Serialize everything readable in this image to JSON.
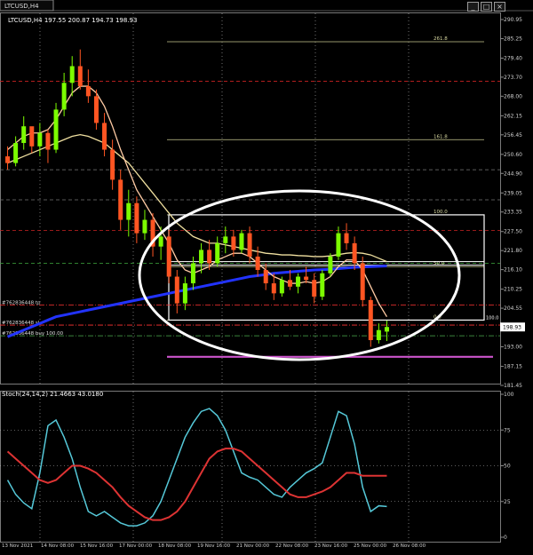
{
  "window": {
    "tab_title": "LTCUSD,H4",
    "buttons": [
      "_",
      "□",
      "×"
    ]
  },
  "chart_data": [
    {
      "type": "candlestick",
      "symbol": "LTCUSD",
      "timeframe": "H4",
      "header": "LTCUSD,H4  197.55 200.87 194.73 198.93",
      "ohlc_header": {
        "open": 197.55,
        "high": 200.87,
        "low": 194.73,
        "close": 198.93
      },
      "ylim": [
        181.45,
        290.95
      ],
      "y_ticks": [
        "290.95",
        "285.25",
        "279.40",
        "273.70",
        "268.00",
        "262.15",
        "256.45",
        "250.60",
        "244.90",
        "239.05",
        "233.35",
        "227.50",
        "221.80",
        "216.10",
        "210.25",
        "204.55",
        "198.93",
        "193.00",
        "187.15",
        "181.45"
      ],
      "last_price": "198.93",
      "x_ticks": [
        "13 Nov 2021",
        "14 Nov 08:00",
        "15 Nov 16:00",
        "17 Nov 00:00",
        "18 Nov 08:00",
        "19 Nov 16:00",
        "21 Nov 00:00",
        "22 Nov 08:00",
        "23 Nov 16:00",
        "25 Nov 00:00",
        "26 Nov 08:00"
      ],
      "candles": [
        [
          250.0,
          253.0,
          246.0,
          248.0
        ],
        [
          248.0,
          256.0,
          247.0,
          254.0
        ],
        [
          254.0,
          262.0,
          252.0,
          259.0
        ],
        [
          259.0,
          258.0,
          251.0,
          253.0
        ],
        [
          253.0,
          260.0,
          250.0,
          257.0
        ],
        [
          257.0,
          258.0,
          248.0,
          252.0
        ],
        [
          252.0,
          266.0,
          251.0,
          264.0
        ],
        [
          264.0,
          275.0,
          262.0,
          272.0
        ],
        [
          272.0,
          280.0,
          268.0,
          277.0
        ],
        [
          277.0,
          282.0,
          270.0,
          271.0
        ],
        [
          271.0,
          276.0,
          266.0,
          268.0
        ],
        [
          268.0,
          270.0,
          258.0,
          260.0
        ],
        [
          260.0,
          263.0,
          250.0,
          252.0
        ],
        [
          252.0,
          255.0,
          240.0,
          243.0
        ],
        [
          243.0,
          246.0,
          228.0,
          231.0
        ],
        [
          231.0,
          240.0,
          226.0,
          236.0
        ],
        [
          236.0,
          238.0,
          224.0,
          227.0
        ],
        [
          227.0,
          234.0,
          225.0,
          231.0
        ],
        [
          231.0,
          233.0,
          220.0,
          223.0
        ],
        [
          223.0,
          229.0,
          219.0,
          226.0
        ],
        [
          226.0,
          228.0,
          212.0,
          214.0
        ],
        [
          214.0,
          216.0,
          203.0,
          206.0
        ],
        [
          206.0,
          214.0,
          204.0,
          212.0
        ],
        [
          212.0,
          220.0,
          210.0,
          218.0
        ],
        [
          218.0,
          224.0,
          215.0,
          222.0
        ],
        [
          222.0,
          225.0,
          216.0,
          218.0
        ],
        [
          218.0,
          226.0,
          217.0,
          224.0
        ],
        [
          224.0,
          229.0,
          221.0,
          226.0
        ],
        [
          226.0,
          228.0,
          220.0,
          222.0
        ],
        [
          222.0,
          228.0,
          221.0,
          227.0
        ],
        [
          227.0,
          229.0,
          218.0,
          220.0
        ],
        [
          220.0,
          223.0,
          214.0,
          216.0
        ],
        [
          216.0,
          218.0,
          210.0,
          212.0
        ],
        [
          212.0,
          215.0,
          207.0,
          209.0
        ],
        [
          209.0,
          214.0,
          208.0,
          213.0
        ],
        [
          213.0,
          216.0,
          210.0,
          211.0
        ],
        [
          211.0,
          215.0,
          209.0,
          214.0
        ],
        [
          214.0,
          217.0,
          212.0,
          213.0
        ],
        [
          213.0,
          215.0,
          206.0,
          208.0
        ],
        [
          208.0,
          216.0,
          207.0,
          215.0
        ],
        [
          215.0,
          221.0,
          214.0,
          220.0
        ],
        [
          220.0,
          229.0,
          219.0,
          227.0
        ],
        [
          227.0,
          230.0,
          222.0,
          224.0
        ],
        [
          224.0,
          226.0,
          216.0,
          218.0
        ],
        [
          218.0,
          220.0,
          205.0,
          207.0
        ],
        [
          207.0,
          208.0,
          193.0,
          195.0
        ],
        [
          195.0,
          200.0,
          194.0,
          198.0
        ],
        [
          197.55,
          200.87,
          194.73,
          198.93
        ]
      ],
      "fibonacci": {
        "levels": [
          {
            "label": "261.8",
            "price": 284.3
          },
          {
            "label": "161.8",
            "price": 255.0
          },
          {
            "label": "100.0",
            "price": 232.5
          },
          {
            "label": "50.0",
            "price": 217.0
          },
          {
            "label": "0.0",
            "price": 201.0
          }
        ],
        "right_labels": [
          "100.0"
        ]
      },
      "orders": [
        {
          "label": "#762836448 tp",
          "price": 205.5,
          "color": "#ff3333"
        },
        {
          "label": "#762836448 sl",
          "price": 199.5,
          "color": "#ff3333"
        },
        {
          "label": "#762836448 buy 100.00",
          "price": 196.3,
          "color": "#4caf50"
        }
      ],
      "horizontal_lines": [
        {
          "price": 272.5,
          "color": "#cc2222",
          "style": "dash"
        },
        {
          "price": 227.8,
          "color": "#cc2222",
          "style": "dash"
        },
        {
          "price": 246.0,
          "color": "#777777",
          "style": "dash"
        },
        {
          "price": 237.0,
          "color": "#777777",
          "style": "dash"
        },
        {
          "price": 218.0,
          "color": "#3faa3f",
          "style": "dash"
        },
        {
          "price": 190.0,
          "color": "#cc55cc",
          "style": "solid"
        }
      ],
      "moving_averages": [
        {
          "color": "#2233ff",
          "values": [
            196,
            197,
            198,
            199,
            200,
            201,
            202,
            202.5,
            203,
            203.5,
            204,
            204.5,
            205,
            205.5,
            206,
            206.5,
            207,
            207.5,
            208,
            208.5,
            209,
            209.5,
            210,
            210.5,
            211,
            211.5,
            212,
            212.5,
            213,
            213.5,
            214,
            214.3,
            214.6,
            215,
            215.2,
            215.4,
            215.6,
            215.8,
            216,
            216.1,
            216.2,
            216.4,
            216.6,
            216.8,
            216.9,
            217.0,
            217.1,
            217.2
          ]
        },
        {
          "color": "#f0e0a0",
          "values": [
            248,
            249,
            250,
            251,
            252,
            253,
            254,
            255,
            256,
            256.5,
            256,
            255,
            254,
            252,
            250,
            248,
            245,
            242,
            239,
            236,
            233,
            230,
            228,
            226,
            225,
            224,
            224,
            223.5,
            223,
            222.5,
            222,
            221.5,
            221,
            220.8,
            220.5,
            220.5,
            220.3,
            220.2,
            220,
            220,
            220.2,
            220.6,
            221,
            221.2,
            221,
            220.5,
            219.5,
            218.5
          ]
        },
        {
          "color": "#ffcba4",
          "values": [
            252,
            254,
            256,
            257,
            257,
            258,
            261,
            265,
            269,
            271,
            271,
            269,
            265,
            259,
            252,
            246,
            240,
            236,
            232,
            228,
            224,
            219,
            216,
            215,
            216,
            217,
            219,
            220,
            221,
            221,
            220,
            218,
            216,
            214,
            213,
            212,
            212,
            212.5,
            212,
            212.5,
            214,
            217,
            219,
            219,
            216,
            211,
            206,
            202
          ]
        }
      ]
    },
    {
      "type": "line",
      "title": "Stoch(24,14,2) 21.4663 43.0180",
      "ylim": [
        0,
        100
      ],
      "y_ticks": [
        "100",
        "75",
        "50",
        "25",
        "0"
      ],
      "series": [
        {
          "color": "#55c8d8",
          "values": [
            40,
            30,
            24,
            20,
            45,
            78,
            82,
            70,
            55,
            35,
            18,
            15,
            18,
            14,
            10,
            8,
            8,
            10,
            15,
            25,
            40,
            55,
            70,
            80,
            88,
            90,
            85,
            75,
            60,
            45,
            42,
            40,
            35,
            30,
            28,
            35,
            40,
            45,
            48,
            52,
            70,
            88,
            85,
            65,
            35,
            18,
            22,
            21.47
          ]
        },
        {
          "color": "#dd3333",
          "values": [
            60,
            55,
            50,
            45,
            40,
            38,
            40,
            45,
            50,
            50,
            48,
            45,
            40,
            35,
            28,
            22,
            18,
            14,
            12,
            12,
            14,
            18,
            25,
            35,
            45,
            55,
            60,
            62,
            62,
            60,
            55,
            50,
            45,
            40,
            35,
            30,
            28,
            28,
            30,
            32,
            35,
            40,
            45,
            45,
            43,
            43,
            43,
            43.02
          ]
        }
      ]
    }
  ]
}
